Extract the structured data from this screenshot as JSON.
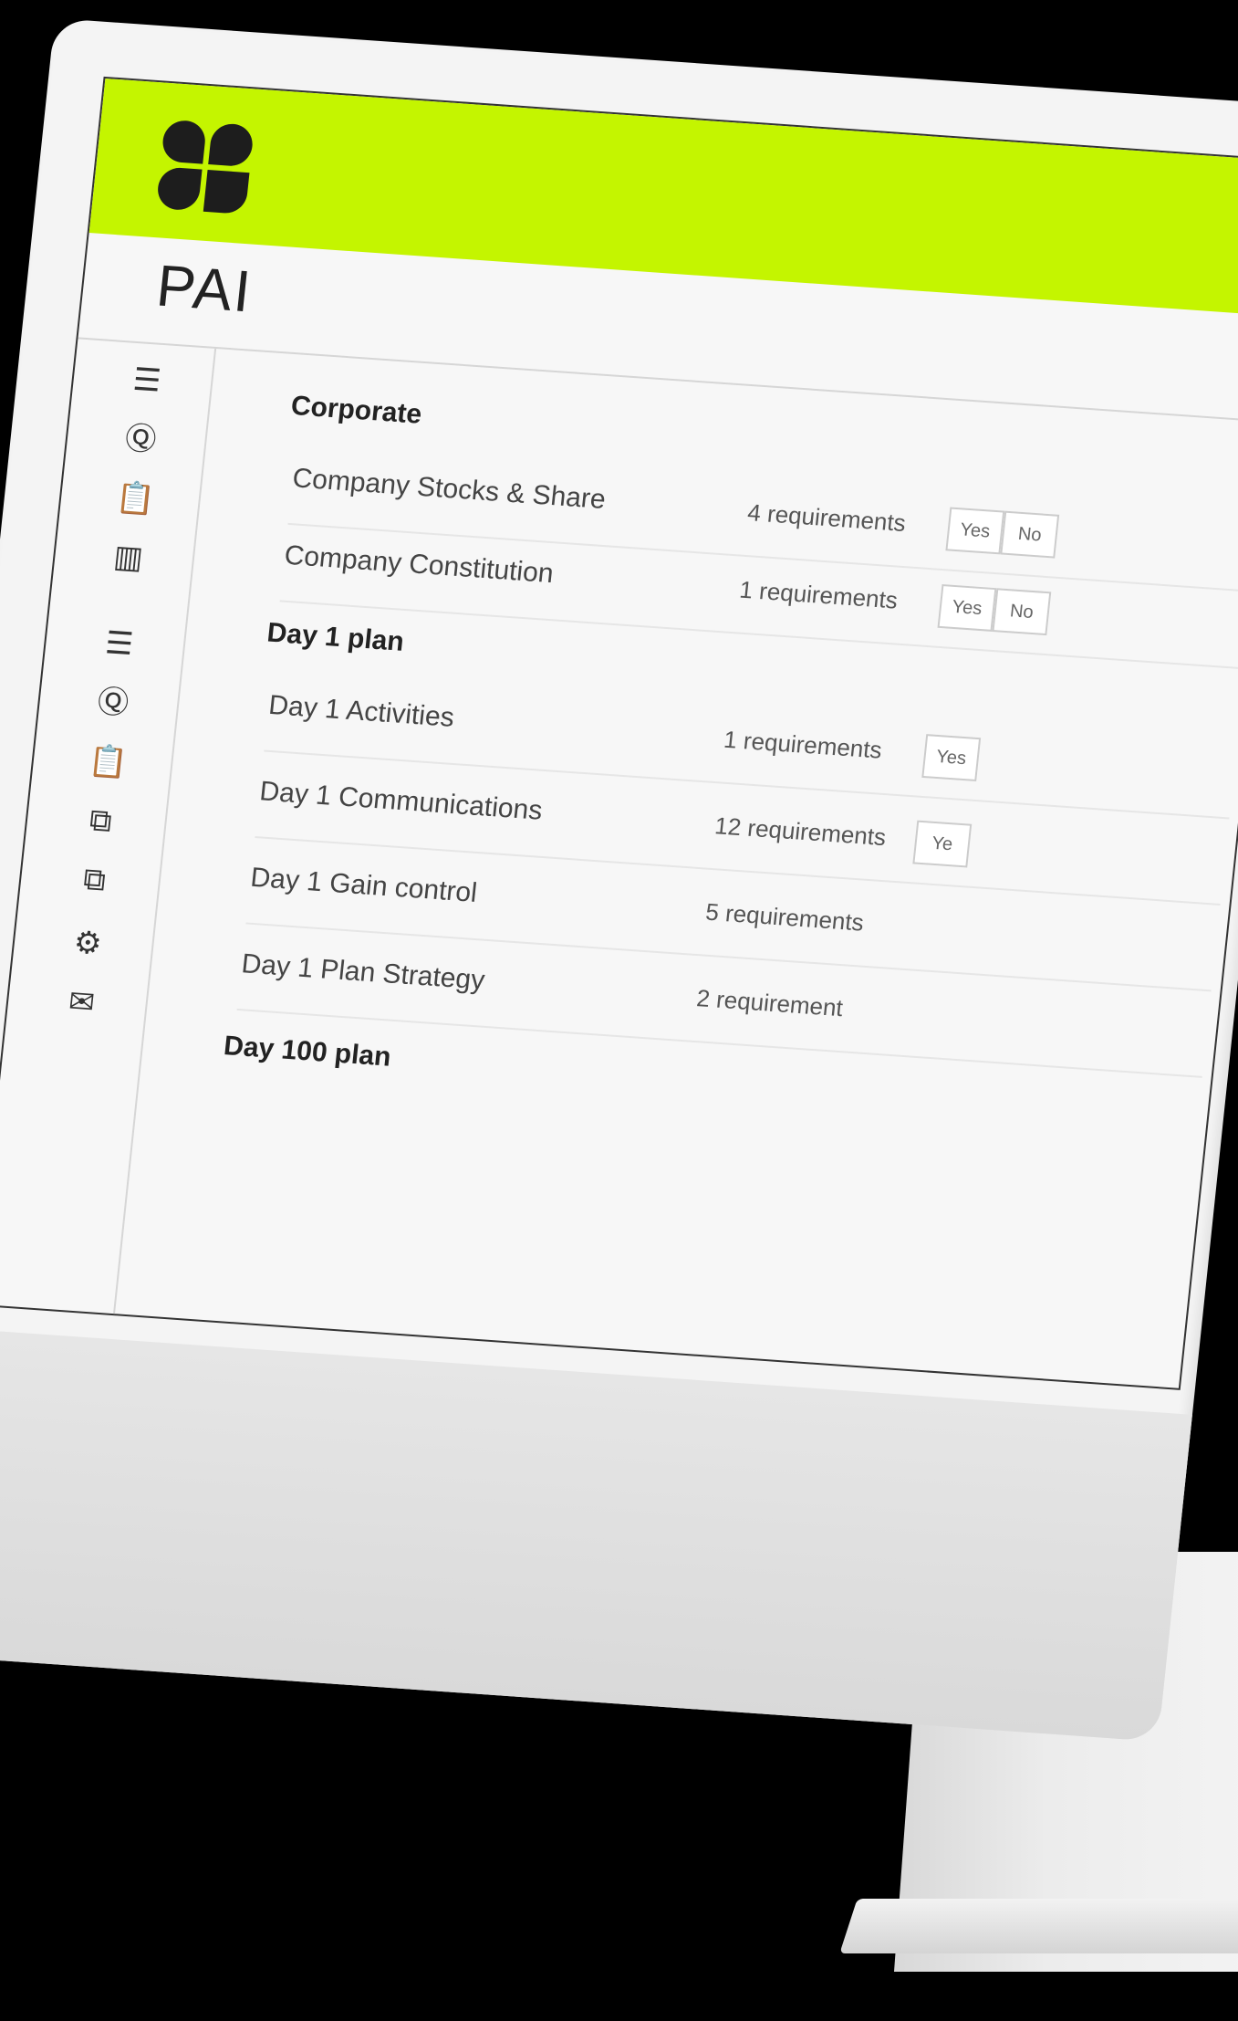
{
  "app": {
    "title": "PAI"
  },
  "sidebar": {
    "icons": [
      "document-list-icon",
      "question-chat-icon",
      "clipboard-list-icon",
      "bar-chart-icon",
      "document-list-icon",
      "question-chat-icon",
      "clipboard-list-icon",
      "user-card-icon",
      "user-cards-icon",
      "gear-icon",
      "mail-icon"
    ]
  },
  "sections": [
    {
      "title": "Corporate"
    },
    {
      "title": "Day 1 plan"
    },
    {
      "title": "Day 100 plan"
    }
  ],
  "rows": [
    {
      "label": "Company Stocks & Share",
      "requirements": "4 requirements",
      "yes": "Yes",
      "no": "No"
    },
    {
      "label": "Company Constitution",
      "requirements": "1 requirements",
      "yes": "Yes",
      "no": "No"
    },
    {
      "label": "Day 1 Activities",
      "requirements": "1 requirements",
      "yes": "Yes",
      "no": ""
    },
    {
      "label": "Day 1 Communications",
      "requirements": "12 requirements",
      "yes": "Ye",
      "no": ""
    },
    {
      "label": "Day 1 Gain control",
      "requirements": "5 requirements",
      "yes": "",
      "no": ""
    },
    {
      "label": "Day 1 Plan Strategy",
      "requirements": "2 requirement",
      "yes": "",
      "no": ""
    }
  ],
  "colors": {
    "accent": "#c4f500",
    "bezel": "#f4f4f4",
    "background": "#000000"
  }
}
